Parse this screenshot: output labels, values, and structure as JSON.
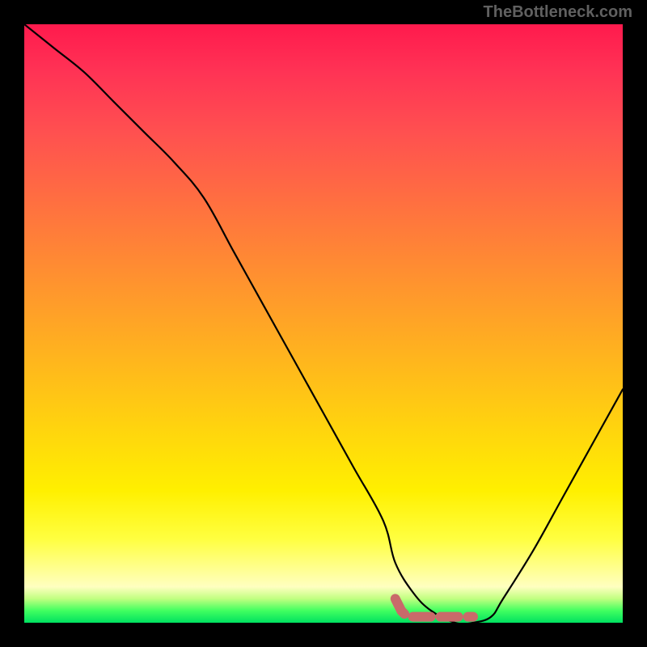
{
  "watermark": "TheBottleneck.com",
  "chart_data": {
    "type": "line",
    "title": "",
    "xlabel": "",
    "ylabel": "",
    "xlim": [
      0,
      100
    ],
    "ylim": [
      0,
      100
    ],
    "series": [
      {
        "name": "bottleneck-curve",
        "x": [
          0,
          5,
          10,
          15,
          20,
          25,
          30,
          35,
          40,
          45,
          50,
          55,
          60,
          62,
          65,
          68,
          72,
          75,
          78,
          80,
          85,
          90,
          95,
          100
        ],
        "values": [
          100,
          96,
          92,
          87,
          82,
          77,
          71,
          62,
          53,
          44,
          35,
          26,
          17,
          10,
          5,
          2,
          0,
          0,
          1,
          4,
          12,
          21,
          30,
          39
        ]
      },
      {
        "name": "optimal-marker",
        "x": [
          62,
          63,
          64,
          65,
          66,
          68,
          72,
          73,
          75
        ],
        "values": [
          4,
          2,
          1,
          1,
          1,
          1,
          1,
          1,
          1
        ]
      }
    ],
    "gradient_stops": [
      {
        "pct": 0,
        "color": "#ff1a4d"
      },
      {
        "pct": 8,
        "color": "#ff3355"
      },
      {
        "pct": 18,
        "color": "#ff5050"
      },
      {
        "pct": 30,
        "color": "#ff7040"
      },
      {
        "pct": 42,
        "color": "#ff9030"
      },
      {
        "pct": 54,
        "color": "#ffb020"
      },
      {
        "pct": 66,
        "color": "#ffd010"
      },
      {
        "pct": 78,
        "color": "#fff000"
      },
      {
        "pct": 86,
        "color": "#ffff40"
      },
      {
        "pct": 91,
        "color": "#ffff90"
      },
      {
        "pct": 94,
        "color": "#ffffc0"
      },
      {
        "pct": 96,
        "color": "#c0ff80"
      },
      {
        "pct": 98,
        "color": "#40ff60"
      },
      {
        "pct": 100,
        "color": "#00e060"
      }
    ]
  }
}
